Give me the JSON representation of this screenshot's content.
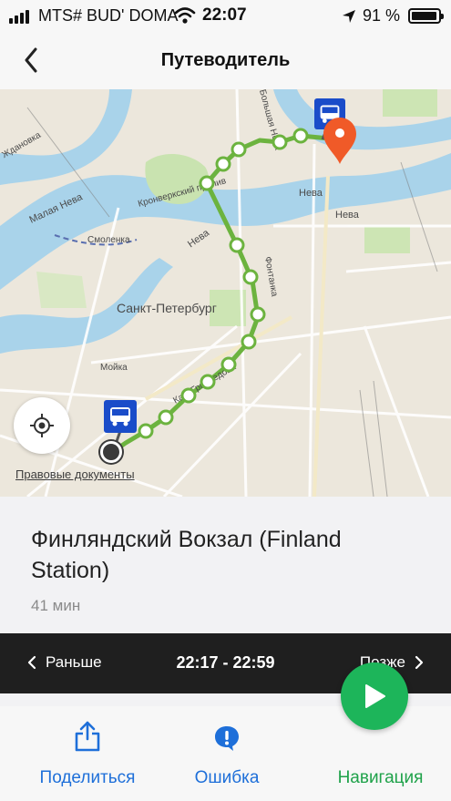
{
  "status_bar": {
    "carrier": "MTS# BUD' DOMA",
    "time": "22:07",
    "battery_percent": "91 %",
    "battery_level": 0.91,
    "icons": [
      "signal-icon",
      "wifi-icon",
      "location-arrow-icon",
      "battery-icon"
    ]
  },
  "header": {
    "title": "Путеводитель",
    "back_icon": "chevron-left-icon"
  },
  "map": {
    "labels": {
      "city": "Санкт-Петербург",
      "neva": "Нева",
      "malaya_neva": "Малая Нева",
      "bolshaya_neva": "Большая Нева",
      "kronverksky": "Кронверкский пролив",
      "smolenka": "Смоленка",
      "fontanka": "Фонтанка",
      "moyka": "Мойка",
      "griboedova": "Кан. Грибоедова",
      "zhdanovka": "Ждановка",
      "bolshaya_nevka": "Большая Нева"
    },
    "legal_link": "Правовые документы",
    "locate_icon": "crosshair-icon",
    "start_icon": "bus-stop-icon",
    "end_icon": "map-pin-icon",
    "route_color": "#6cb33f",
    "end_pin_color": "#f05a28"
  },
  "route": {
    "station_name": "Финляндский Вокзал (Finland Station)",
    "duration": "41 мин"
  },
  "time_bar": {
    "earlier_label": "Раньше",
    "time_range": "22:17 - 22:59",
    "later_label": "Позже"
  },
  "toolbar": {
    "share_label": "Поделиться",
    "error_label": "Ошибка",
    "navigation_label": "Навигация",
    "share_icon": "share-icon",
    "error_icon": "exclamation-bubble-icon",
    "play_icon": "play-icon",
    "accent_blue": "#1e6fd9",
    "accent_green": "#1fa24a"
  }
}
